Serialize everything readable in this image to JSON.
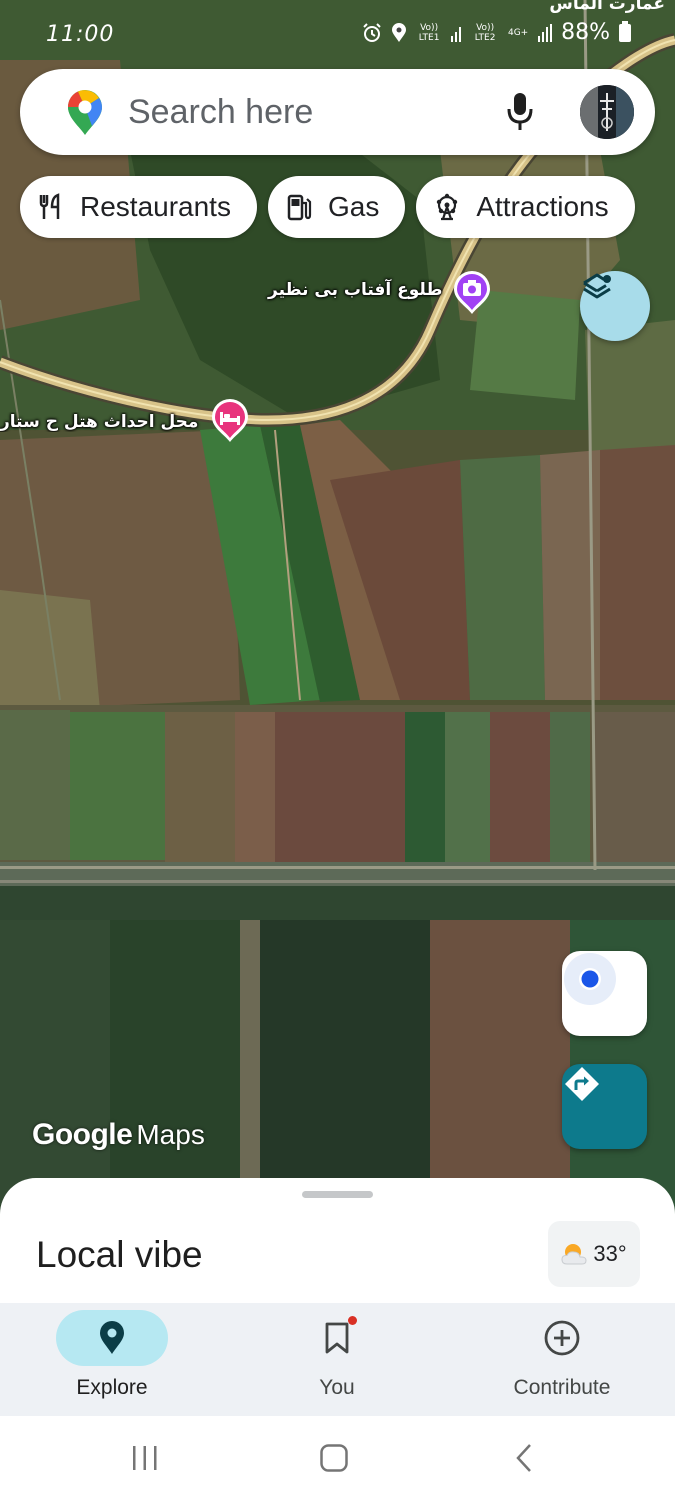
{
  "status_bar": {
    "time": "11:00",
    "sim1": "Vo)) LTE1",
    "sim2": "Vo)) LTE2",
    "network": "4G+",
    "battery": "88%",
    "top_right_text": "عمارت الماس"
  },
  "search": {
    "placeholder": "Search here"
  },
  "chips": [
    {
      "label": "Restaurants",
      "icon": "fork-knife-icon"
    },
    {
      "label": "Gas",
      "icon": "gas-pump-icon"
    },
    {
      "label": "Attractions",
      "icon": "ferris-wheel-icon"
    }
  ],
  "map": {
    "places": [
      {
        "name": "طلوع آفتاب بی نظیر",
        "icon": "camera-icon",
        "color": "#a142f4"
      },
      {
        "name": "محل احداث هتل ح ستار",
        "icon": "hotel-bed-icon",
        "color": "#e8347d"
      }
    ],
    "brand": {
      "google": "Google",
      "maps": "Maps"
    }
  },
  "sheet": {
    "title": "Local vibe",
    "weather": {
      "temp": "33°",
      "icon": "partly-sunny-icon"
    }
  },
  "nav": {
    "items": [
      {
        "label": "Explore",
        "icon": "location-pin-icon",
        "active": true
      },
      {
        "label": "You",
        "icon": "bookmark-icon",
        "active": false
      },
      {
        "label": "Contribute",
        "icon": "add-circle-icon",
        "active": false
      }
    ]
  },
  "colors": {
    "accent": "#0d7a8c",
    "nav_active_bg": "#b6e8f2",
    "notification": "#d93025"
  }
}
